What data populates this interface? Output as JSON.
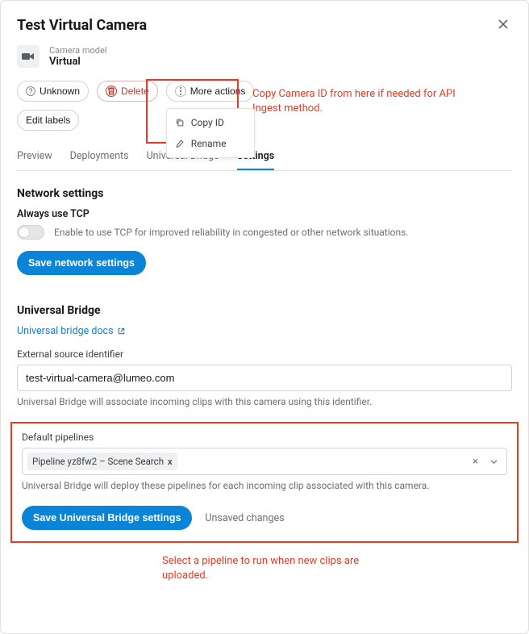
{
  "header": {
    "title": "Test Virtual Camera",
    "close_icon": "close-icon"
  },
  "camera_model": {
    "label": "Camera model",
    "value": "Virtual",
    "icon": "camera-icon"
  },
  "actions": {
    "unknown_icon": "?",
    "unknown_label": "Unknown",
    "delete_icon": "trash-icon",
    "delete_label": "Delete",
    "more_icon": "more-vertical-icon",
    "more_label": "More actions",
    "dropdown": {
      "copy_id_icon": "copy-icon",
      "copy_id_label": "Copy ID",
      "rename_icon": "pencil-icon",
      "rename_label": "Rename"
    },
    "edit_labels_label": "Edit labels"
  },
  "annotations": {
    "top": "Copy Camera ID from here if needed for API Ingest method.",
    "bottom": "Select a pipeline to run when new clips are uploaded."
  },
  "tabs": [
    {
      "label": "Preview",
      "name": "tab-preview",
      "active": false
    },
    {
      "label": "Deployments",
      "name": "tab-deployments",
      "active": false
    },
    {
      "label": "Universal Bridge",
      "name": "tab-universal-bridge",
      "active": false
    },
    {
      "label": "Settings",
      "name": "tab-settings",
      "active": true
    }
  ],
  "network": {
    "heading": "Network settings",
    "tcp_label": "Always use TCP",
    "tcp_help": "Enable to use TCP for improved reliability in congested or other network situations.",
    "toggle_on": false,
    "save_label": "Save network settings"
  },
  "universal_bridge": {
    "heading": "Universal Bridge",
    "docs_label": "Universal bridge docs",
    "docs_icon": "external-link-icon",
    "external_id_label": "External source identifier",
    "external_id_value": "test-virtual-camera@lumeo.com",
    "external_id_hint": "Universal Bridge will associate incoming clips with this camera using this identifier.",
    "default_pipelines_label": "Default pipelines",
    "pipeline_chip": "Pipeline yz8fw2 – Scene Search",
    "pipeline_chip_remove": "x",
    "pipelines_hint": "Universal Bridge will deploy these pipelines for each incoming clip associated with this camera.",
    "save_label": "Save Universal Bridge settings",
    "unsaved_label": "Unsaved changes",
    "clear_icon": "×",
    "chevron_icon": "chevron-down-icon"
  }
}
